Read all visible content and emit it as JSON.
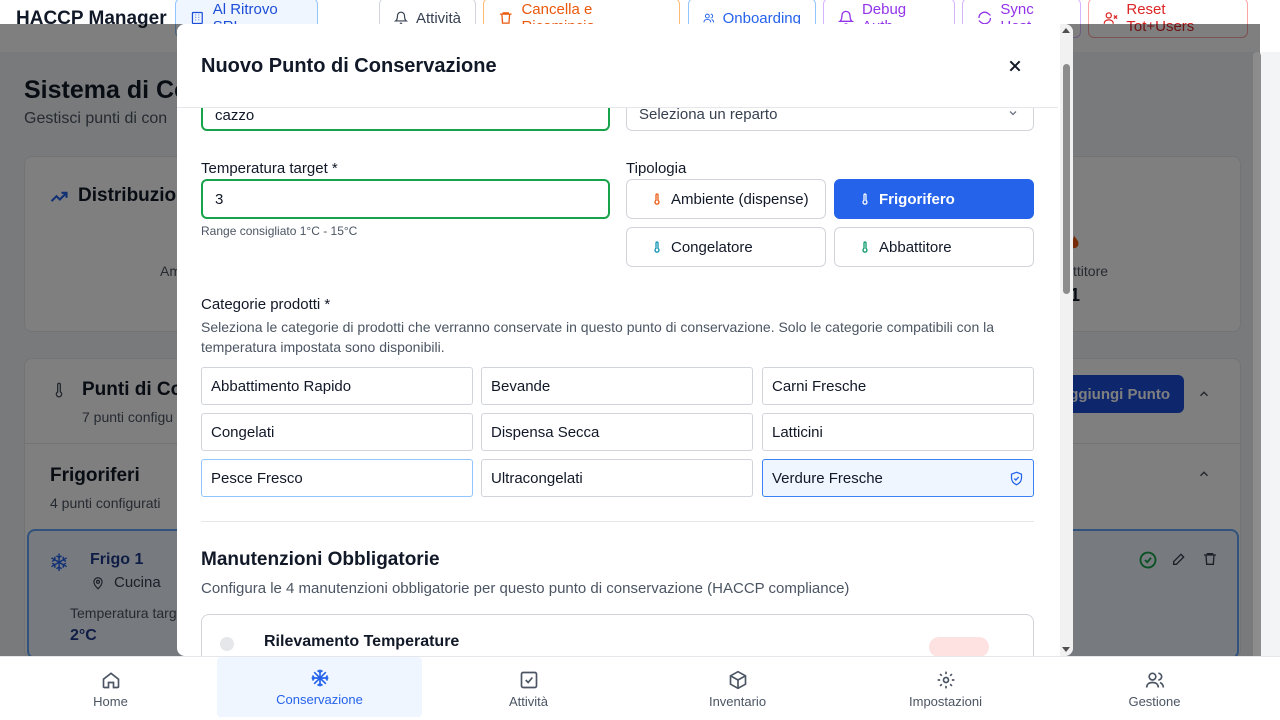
{
  "header": {
    "title": "HACCP Manager",
    "company": "Al Ritrovo SRL",
    "buttons": {
      "attivita": "Attività",
      "cancella": "Cancella e Ricomincia",
      "onboarding": "Onboarding",
      "debug": "Debug Auth",
      "sync": "Sync Host",
      "reset": "Reset Tot+Users"
    }
  },
  "background": {
    "page_title": "Sistema di Co",
    "page_subtitle": "Gestisci punti di con",
    "distribution_title": "Distribuzion",
    "dist_label_left": "Am",
    "dist_label_right": "ttitore",
    "dist_value_right": "1",
    "points_title": "Punti di Co",
    "points_sub": "7 punti configu",
    "add_point": "Aggiungi Punto",
    "fridges_title": "Frigoriferi",
    "fridges_sub": "4 punti configurati",
    "fridge_name": "Frigo 1",
    "fridge_location": "Cucina",
    "fridge_temp_label": "Temperatura targ",
    "fridge_temp_value": "2°C"
  },
  "modal": {
    "title": "Nuovo Punto di Conservazione",
    "name_value": "cazzo",
    "reparto_placeholder": "Seleziona un reparto",
    "temp_label": "Temperatura target *",
    "temp_value": "3",
    "temp_hint": "Range consigliato 1°C - 15°C",
    "tipologia_label": "Tipologia",
    "types": [
      {
        "label": "Ambiente (dispense)",
        "color": "#ea580c"
      },
      {
        "label": "Frigorifero",
        "color": "#ffffff"
      },
      {
        "label": "Congelatore",
        "color": "#0891b2"
      },
      {
        "label": "Abbattitore",
        "color": "#059669"
      }
    ],
    "categories_label": "Categorie prodotti *",
    "categories_desc": "Seleziona le categorie di prodotti che verranno conservate in questo punto di conservazione. Solo le categorie compatibili con la temperatura impostata sono disponibili.",
    "categories": [
      "Abbattimento Rapido",
      "Bevande",
      "Carni Fresche",
      "Congelati",
      "Dispensa Secca",
      "Latticini",
      "Pesce Fresco",
      "Ultracongelati",
      "Verdure Fresche"
    ],
    "maint_title": "Manutenzioni Obbligatorie",
    "maint_desc": "Configura le 4 manutenzioni obbligatorie per questo punto di conservazione (HACCP compliance)",
    "maint_first": "Rilevamento Temperature"
  },
  "nav": {
    "items": [
      "Home",
      "Conservazione",
      "Attività",
      "Inventario",
      "Impostazioni",
      "Gestione"
    ]
  },
  "colors": {
    "primary": "#2563eb",
    "success": "#16a34a",
    "orange": "#ea580c",
    "purple": "#9333ea",
    "red": "#dc2626"
  }
}
